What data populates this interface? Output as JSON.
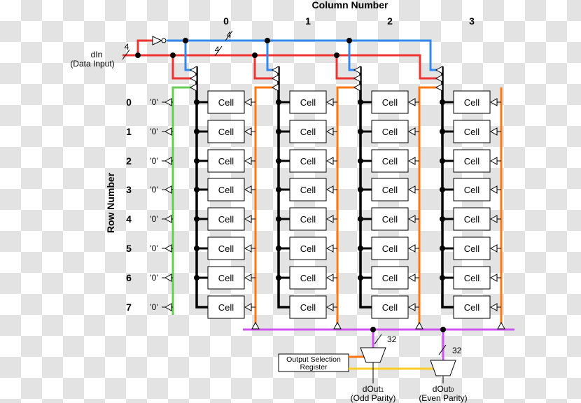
{
  "title_columns": "Column Number",
  "title_rows": "Row Number",
  "columns": [
    "0",
    "1",
    "2",
    "3"
  ],
  "rows": [
    "0",
    "1",
    "2",
    "3",
    "4",
    "5",
    "6",
    "7"
  ],
  "cell_label": "Cell",
  "zero_label": "'0'",
  "input": {
    "name": "dIn",
    "desc": "(Data Input)",
    "width": "4"
  },
  "bus_width_labels": [
    "4",
    "4"
  ],
  "output_bus_width": "32",
  "register_label": [
    "Output Selection",
    "Register"
  ],
  "outputs": [
    {
      "name": "dOut",
      "sub": "1",
      "desc": "(Odd Parity)"
    },
    {
      "name": "dOut",
      "sub": "0",
      "desc": "(Even Parity)"
    }
  ],
  "colors": {
    "red": "#ee3333",
    "blue": "#3388ee",
    "green": "#66cc55",
    "orange": "#ff7711",
    "purple": "#cc55ee",
    "yellow": "#ffcc22",
    "black": "#000000"
  }
}
